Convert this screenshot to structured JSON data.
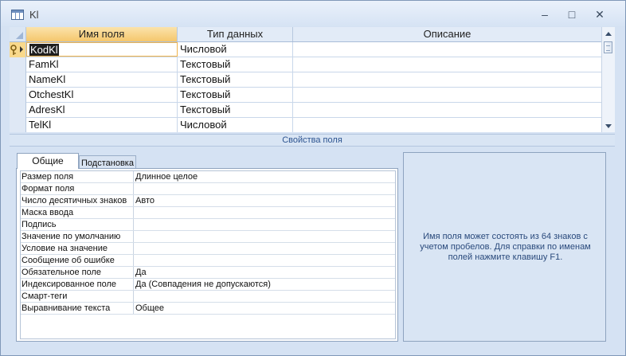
{
  "window": {
    "title": "Kl",
    "controls": {
      "minimize": "–",
      "maximize": "□",
      "close": "✕"
    }
  },
  "grid": {
    "headers": {
      "name": "Имя поля",
      "type": "Тип данных",
      "description": "Описание"
    },
    "rows": [
      {
        "name": "KodKl",
        "type": "Числовой",
        "description": "",
        "key": true,
        "selected": true
      },
      {
        "name": "FamKl",
        "type": "Текстовый",
        "description": ""
      },
      {
        "name": "NameKl",
        "type": "Текстовый",
        "description": ""
      },
      {
        "name": "OtchestKl",
        "type": "Текстовый",
        "description": ""
      },
      {
        "name": "AdresKl",
        "type": "Текстовый",
        "description": ""
      },
      {
        "name": "TelKl",
        "type": "Числовой",
        "description": ""
      }
    ]
  },
  "properties": {
    "section_title": "Свойства поля",
    "tabs": [
      "Общие",
      "Подстановка"
    ],
    "active_tab": "Общие",
    "rows": [
      {
        "name": "Размер поля",
        "value": "Длинное целое"
      },
      {
        "name": "Формат поля",
        "value": ""
      },
      {
        "name": "Число десятичных знаков",
        "value": "Авто"
      },
      {
        "name": "Маска ввода",
        "value": ""
      },
      {
        "name": "Подпись",
        "value": ""
      },
      {
        "name": "Значение по умолчанию",
        "value": ""
      },
      {
        "name": "Условие на значение",
        "value": ""
      },
      {
        "name": "Сообщение об ошибке",
        "value": ""
      },
      {
        "name": "Обязательное поле",
        "value": "Да"
      },
      {
        "name": "Индексированное поле",
        "value": "Да (Совпадения не допускаются)"
      },
      {
        "name": "Смарт-теги",
        "value": ""
      },
      {
        "name": "Выравнивание текста",
        "value": "Общее"
      }
    ],
    "help_text": "Имя поля может состоять из 64 знаков с учетом пробелов.  Для справки по именам полей нажмите клавишу F1."
  },
  "colors": {
    "frame": "#d5e2f3",
    "header_accent": "#f7cf7c",
    "link_blue": "#2d5490"
  }
}
